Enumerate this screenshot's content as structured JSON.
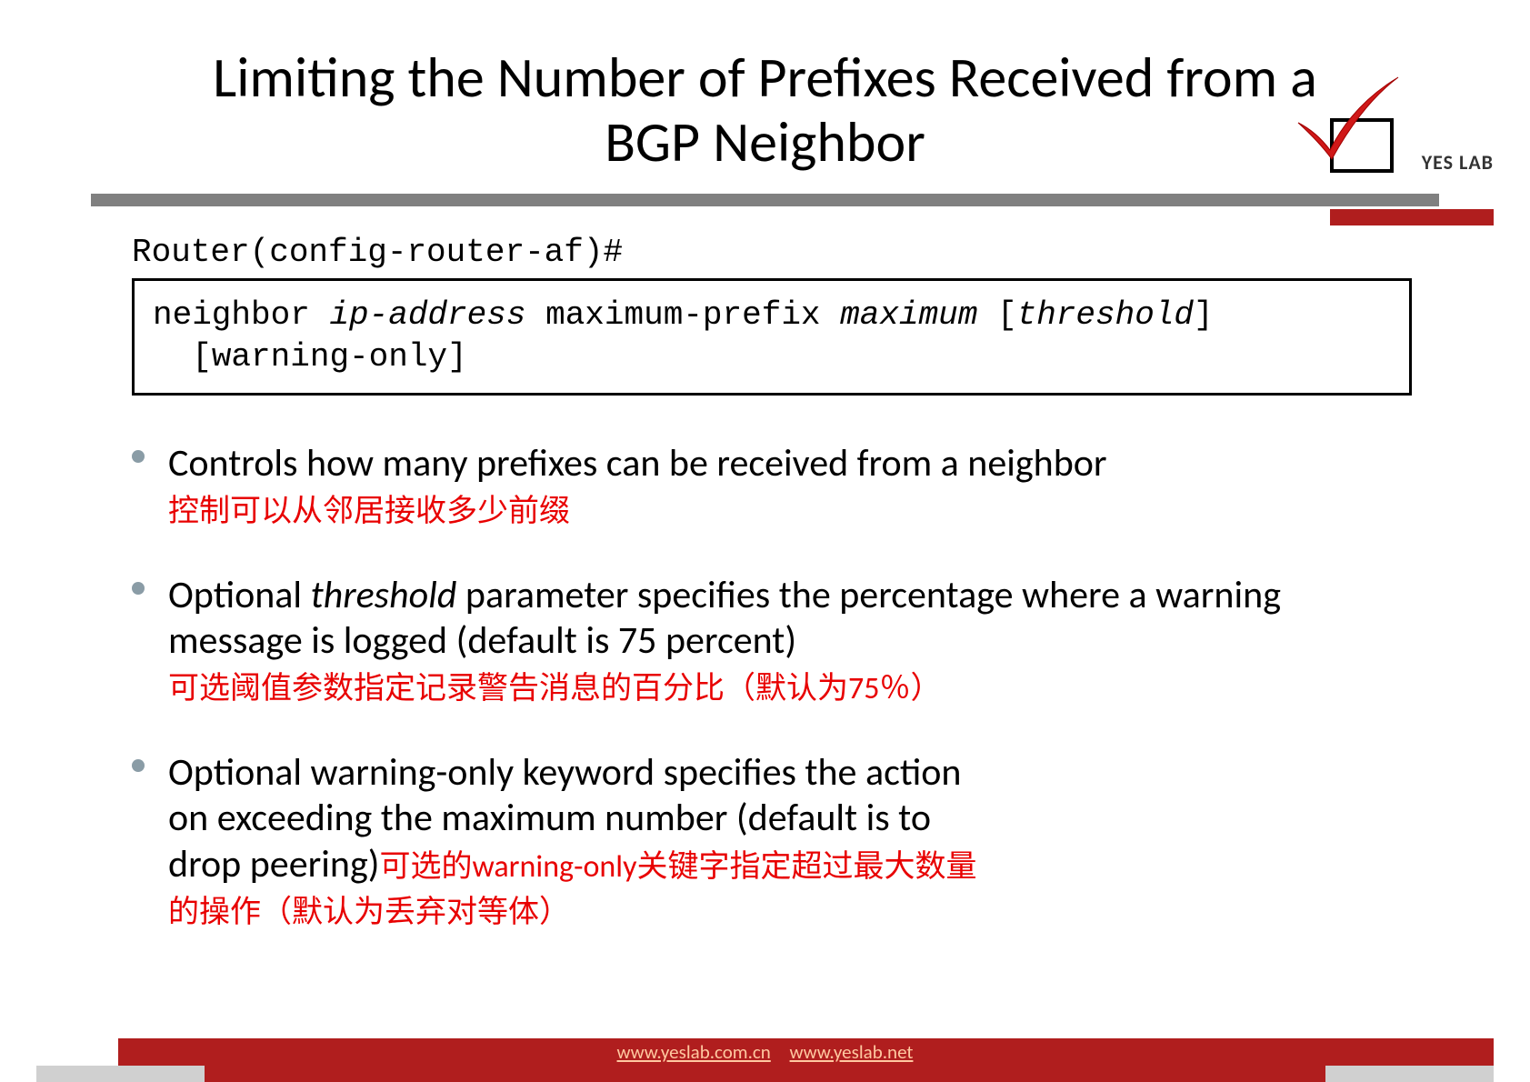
{
  "slide": {
    "title": "Limiting the Number of Prefixes Received from a BGP Neighbor",
    "logo": {
      "text": "YES LAB",
      "icon": "checkmark-box"
    },
    "cli": {
      "prompt": "Router(config-router-af)#",
      "command_part1": "neighbor ",
      "command_part2": "ip-address",
      "command_part3": " maximum-prefix ",
      "command_part4": "maximum",
      "command_part5": " [",
      "command_part6": "threshold",
      "command_part7": "]",
      "command_part8": "[warning-only]"
    },
    "bullets": [
      {
        "en": "Controls how many prefixes can be received from a neighbor",
        "cn": "控制可以从邻居接收多少前缀"
      },
      {
        "en_part1": "Optional ",
        "en_italic": "threshold",
        "en_part2": " parameter specifies the percentage where a warning message is logged (default is 75 percent)",
        "cn": "可选阈值参数指定记录警告消息的百分比（默认为75％）"
      },
      {
        "en": "Optional warning-only keyword specifies the action on exceeding the maximum number (default is to drop peering)",
        "cn_part1": "可选的warning-only关键字指定超过最大数量的操作（默认为丢弃对等体）"
      }
    ],
    "footer": {
      "link1": "www.yeslab.com.cn",
      "link2": "www.yeslab.net"
    }
  }
}
